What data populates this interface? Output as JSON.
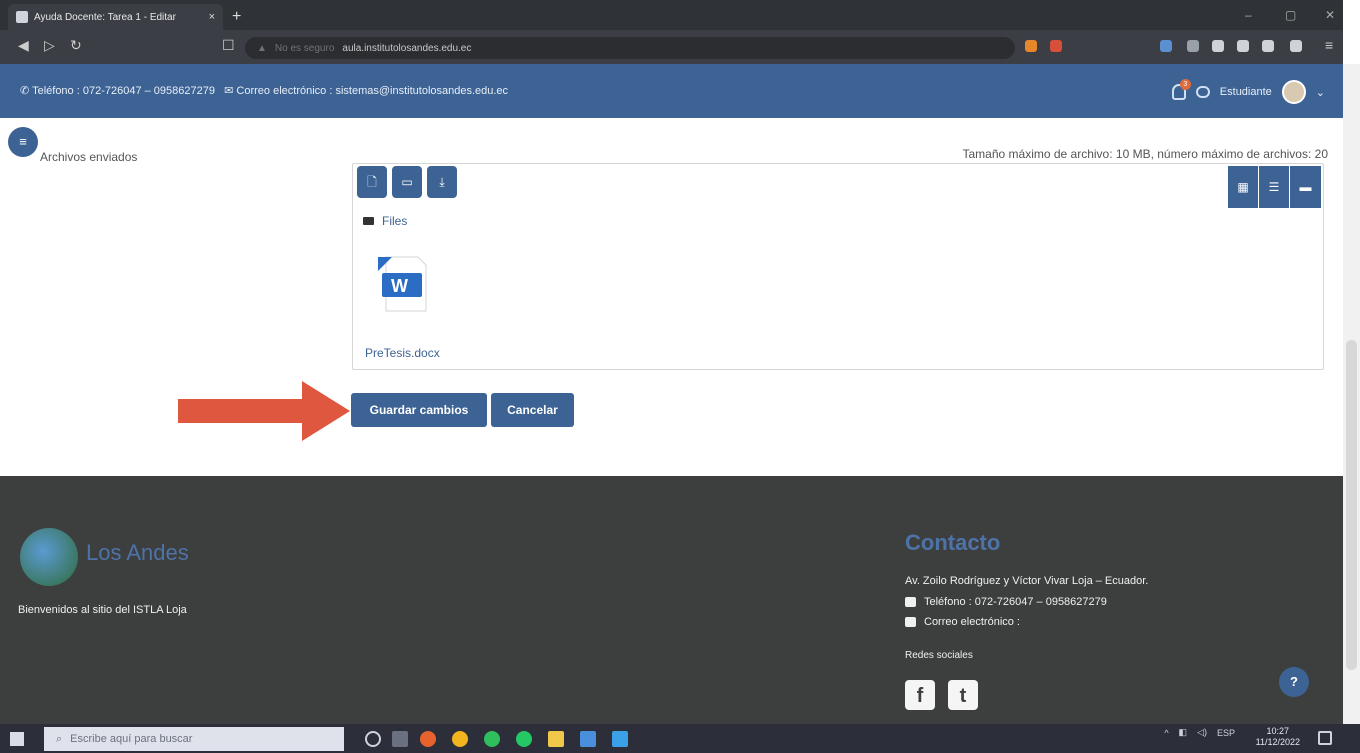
{
  "browser": {
    "tab_title": "Ayuda Docente: Tarea 1 - Editar",
    "tab_close": "×",
    "new_tab": "+",
    "url_security": "No es seguro",
    "url_text": "aula.institutolosandes.edu.ec",
    "window_controls": {
      "minimize": "–",
      "maximize": "▢",
      "close": "✕"
    }
  },
  "site_header": {
    "phone_text": "Teléfono : 072-726047 – 0958627279",
    "email_text": "Correo electrónico : sistemas@institutolosandes.edu.ec",
    "notification_count": "3",
    "user_name": "Estudiante"
  },
  "form": {
    "section_label": "Archivos enviados",
    "max_info": "Tamaño máximo de archivo: 10 MB, número máximo de archivos: 20",
    "breadcrumb": "Files",
    "file_name": "PreTesis.docx",
    "save_button": "Guardar cambios",
    "cancel_button": "Cancelar"
  },
  "footer": {
    "logo_text": "Los Andes",
    "welcome": "Bienvenidos al sitio del ISTLA Loja",
    "contact_title": "Contacto",
    "address": "Av. Zoilo Rodríguez y Víctor Vivar Loja – Ecuador.",
    "phone": "Teléfono : 072-726047 – 0958627279",
    "email_label": "Correo electrónico :",
    "social_title": "Redes sociales",
    "help": "?"
  },
  "taskbar": {
    "search_placeholder": "Escribe aquí para buscar",
    "language": "ESP",
    "time": "10:27",
    "date": "11/12/2022"
  },
  "colors": {
    "brand_blue": "#3d6394",
    "arrow": "#e0573f",
    "footer_bg": "#3d3f3e"
  }
}
